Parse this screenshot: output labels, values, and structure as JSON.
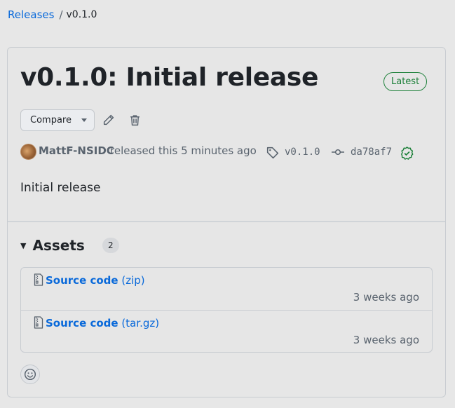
{
  "breadcrumb": {
    "root_label": "Releases",
    "separator": "/",
    "current": "v0.1.0"
  },
  "release": {
    "title": "v0.1.0: Initial release",
    "latest_label": "Latest",
    "compare_label": "Compare",
    "author": "MattF-NSIDC",
    "released_text": "released this 5 minutes ago",
    "tag": "v0.1.0",
    "commit": "da78af7",
    "body": "Initial release"
  },
  "assets": {
    "label": "Assets",
    "count": "2",
    "items": [
      {
        "name": "Source code",
        "ext": "(zip)",
        "time": "3 weeks ago"
      },
      {
        "name": "Source code",
        "ext": "(tar.gz)",
        "time": "3 weeks ago"
      }
    ]
  },
  "colors": {
    "link": "#0969da",
    "success": "#1a7f37",
    "muted": "#59636e"
  },
  "icons": [
    "pencil-icon",
    "trash-icon",
    "tag-icon",
    "commit-icon",
    "verified-icon",
    "file-zip-icon",
    "smiley-icon"
  ]
}
